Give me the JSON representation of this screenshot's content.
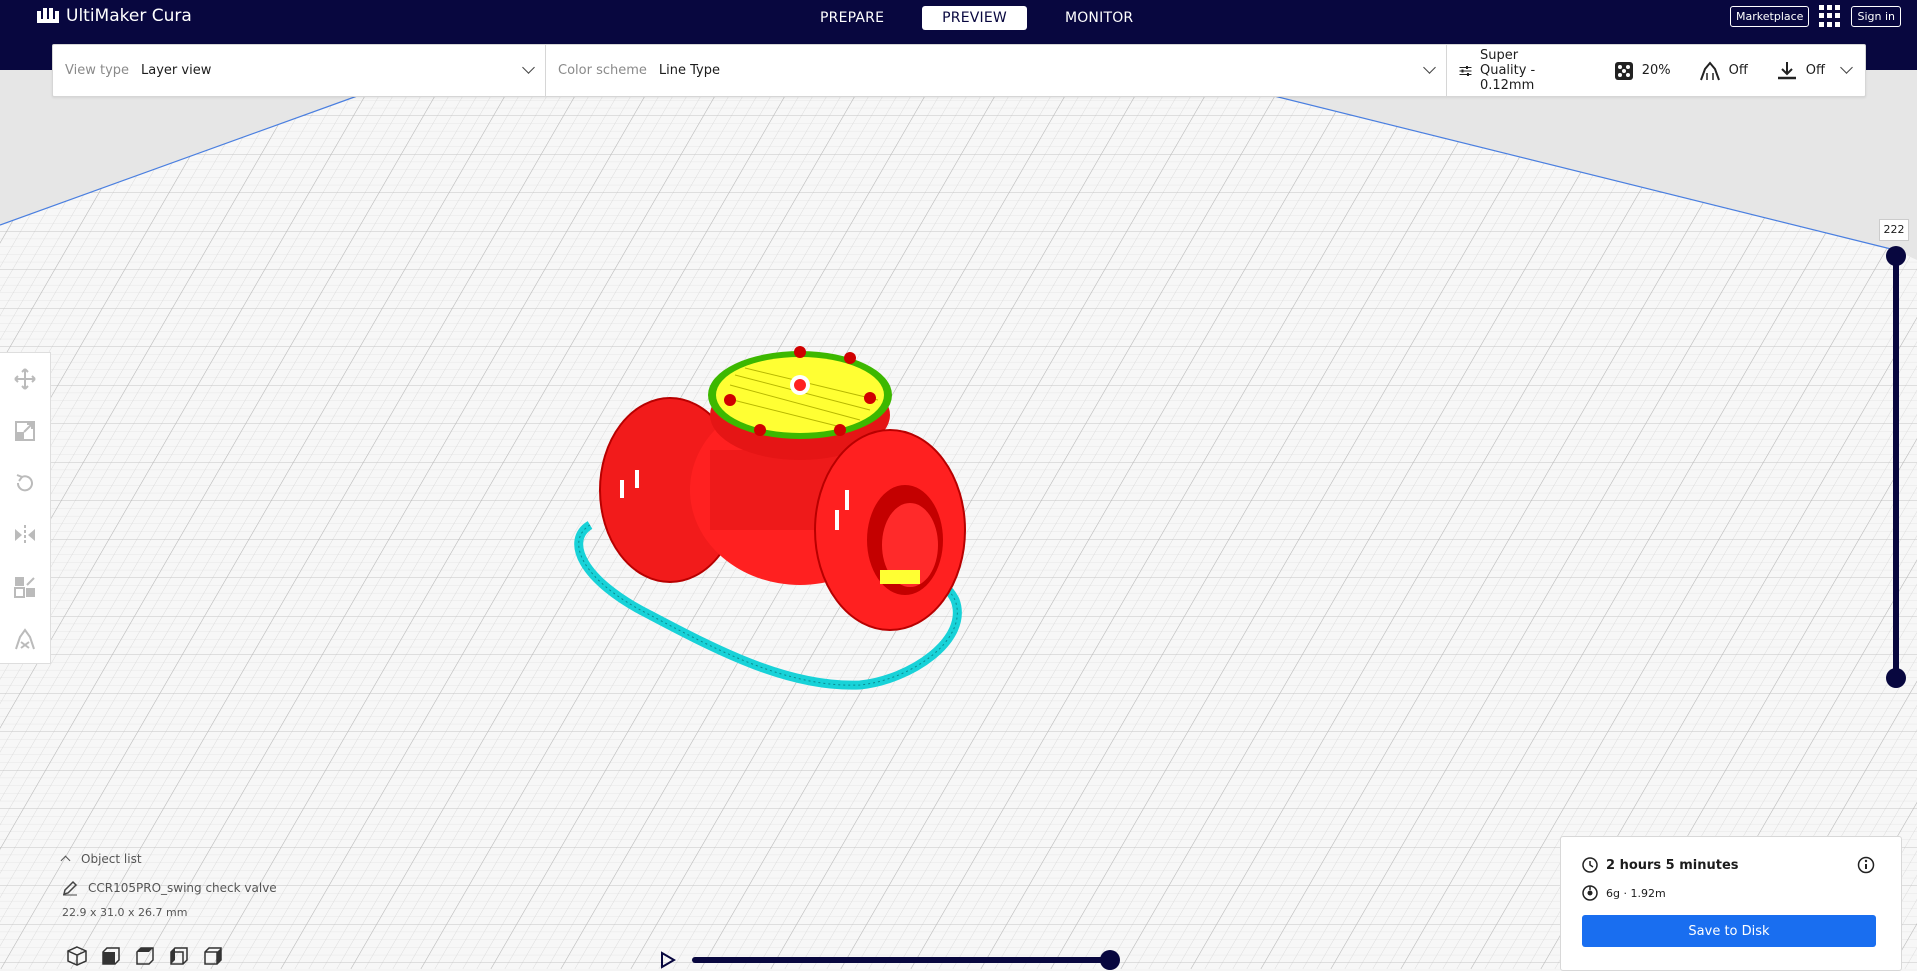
{
  "app": {
    "title": "UltiMaker Cura"
  },
  "tabs": [
    {
      "label": "PREPARE"
    },
    {
      "label": "PREVIEW"
    },
    {
      "label": "MONITOR"
    }
  ],
  "header": {
    "marketplace_label": "Marketplace",
    "signin_label": "Sign in"
  },
  "toolbar": {
    "view_type_label": "View type",
    "view_type_value": "Layer view",
    "color_scheme_label": "Color scheme",
    "color_scheme_value": "Line Type",
    "profile": "Super Quality - 0.12mm",
    "infill": "20%",
    "support": "Off",
    "adhesion": "Off"
  },
  "layer_slider": {
    "current": "222"
  },
  "object_list": {
    "header": "Object list",
    "object_name": "CCR105PRO_swing check valve",
    "dimensions": "22.9 x 31.0 x 26.7 mm"
  },
  "print_info": {
    "time": "2 hours 5 minutes",
    "material": "6g · 1.92m",
    "save_label": "Save to Disk"
  },
  "colors": {
    "navy": "#08073f",
    "accent_blue": "#196ef0",
    "model_red": "#ff1f1f",
    "skirt_cyan": "#18d2d8",
    "infill_yellow": "#ffff33"
  }
}
